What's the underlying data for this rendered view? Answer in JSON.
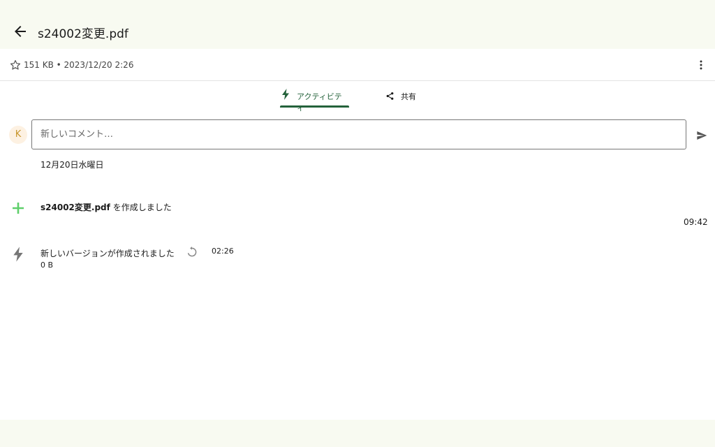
{
  "header": {
    "title": "s24002変更.pdf",
    "back_icon": "arrow-left-icon"
  },
  "info": {
    "meta": "151 KB • 2023/12/20 2:26",
    "star_icon": "star-outline-icon",
    "more_icon": "more-vertical-icon"
  },
  "tabs": [
    {
      "label": "アクティビティ",
      "icon": "lightning-icon",
      "selected": true
    },
    {
      "label": "共有",
      "icon": "share-icon",
      "selected": false
    }
  ],
  "comment": {
    "avatar_initial": "K",
    "placeholder": "新しいコメント…",
    "send_icon": "send-icon"
  },
  "activity": {
    "date_heading": "12月20日水曜日",
    "items": [
      {
        "icon": "plus-icon",
        "file": "s24002変更.pdf",
        "action": "を作成しました",
        "time": "09:42"
      },
      {
        "icon": "lightning-icon",
        "text": "新しいバージョンが作成されました",
        "restore_icon": "restore-icon",
        "time": "02:26",
        "size": "0 B"
      }
    ]
  },
  "colors": {
    "accent": "#24623b",
    "plus": "#5fcf6b",
    "topbar": "#f8faf1",
    "avatar_bg": "#fdf1e2",
    "avatar_fg": "#c8962c"
  }
}
